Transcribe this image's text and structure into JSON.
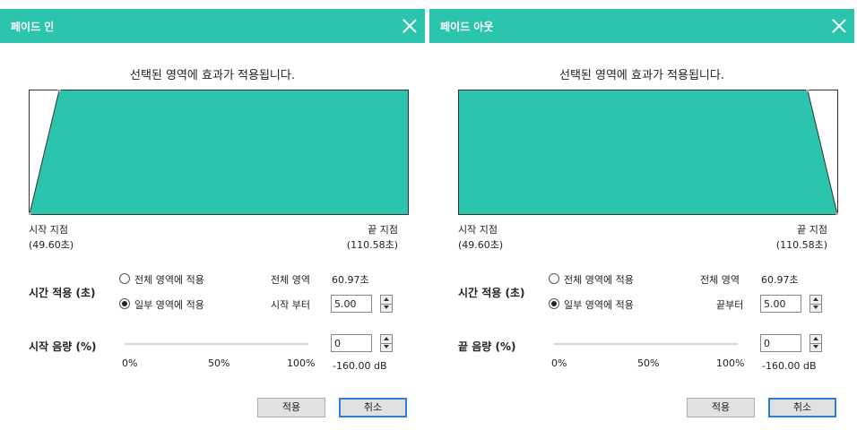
{
  "fade_in": {
    "title": "페이드 인",
    "heading": "선택된 영역에 효과가 적용됩니다.",
    "start_point_label": "시작 지점",
    "start_point_time": "(49.60초)",
    "end_point_label": "끝 지점",
    "end_point_time": "(110.58초)",
    "time_apply_label": "시간 적용 (초)",
    "radio_all": "전체 영역에 적용",
    "radio_partial": "일부 영역에 적용",
    "selected_radio": "partial",
    "total_area_label": "전체 영역",
    "total_area_value": "60.97초",
    "start_from_label": "시작 부터",
    "start_from_value": "5.00",
    "volume_label": "시작 음량 (%)",
    "volume_value": "0",
    "volume_db": "-160.00 dB",
    "tick_0": "0%",
    "tick_50": "50%",
    "tick_100": "100%",
    "apply_button": "적용",
    "cancel_button": "취소"
  },
  "fade_out": {
    "title": "페이드 아웃",
    "heading": "선택된 영역에 효과가 적용됩니다.",
    "start_point_label": "시작 지점",
    "start_point_time": "(49.60초)",
    "end_point_label": "끝 지점",
    "end_point_time": "(110.58초)",
    "time_apply_label": "시간 적용 (초)",
    "radio_all": "전체 영역에 적용",
    "radio_partial": "일부 영역에 적용",
    "selected_radio": "partial",
    "total_area_label": "전체 영역",
    "total_area_value": "60.97초",
    "end_from_label": "끝부터",
    "end_from_value": "5.00",
    "volume_label": "끝 음량 (%)",
    "volume_value": "0",
    "volume_db": "-160.00 dB",
    "tick_0": "0%",
    "tick_50": "50%",
    "tick_100": "100%",
    "apply_button": "적용",
    "cancel_button": "취소"
  },
  "colors": {
    "accent": "#2bc4ad",
    "primary_button_border": "#2f7fd6"
  }
}
